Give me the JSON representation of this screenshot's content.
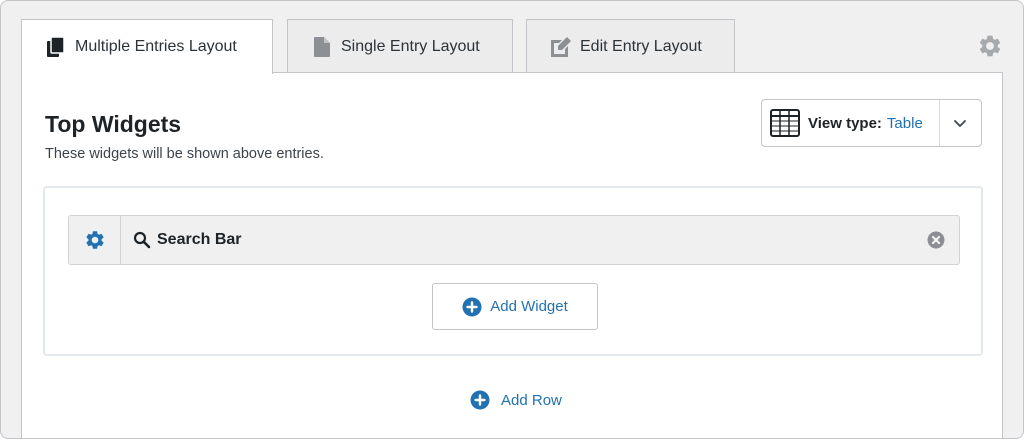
{
  "tabs": [
    {
      "label": "Multiple Entries Layout",
      "icon": "copy-icon",
      "active": true
    },
    {
      "label": "Single Entry Layout",
      "icon": "document-icon",
      "active": false
    },
    {
      "label": "Edit Entry Layout",
      "icon": "edit-icon",
      "active": false
    }
  ],
  "settings_icon": "gear-icon",
  "section": {
    "title": "Top Widgets",
    "subtitle": "These widgets will be shown above entries."
  },
  "view_type": {
    "label": "View type:",
    "value": "Table",
    "icon": "table-icon"
  },
  "widget": {
    "label": "Search Bar",
    "settings_icon": "gear-icon",
    "icon": "search-icon",
    "remove_icon": "close-circle-icon"
  },
  "buttons": {
    "add_widget": "Add Widget",
    "add_row": "Add Row"
  },
  "colors": {
    "accent": "#2271b1",
    "icon_gray": "#8c8f94",
    "text": "#1d2327"
  }
}
